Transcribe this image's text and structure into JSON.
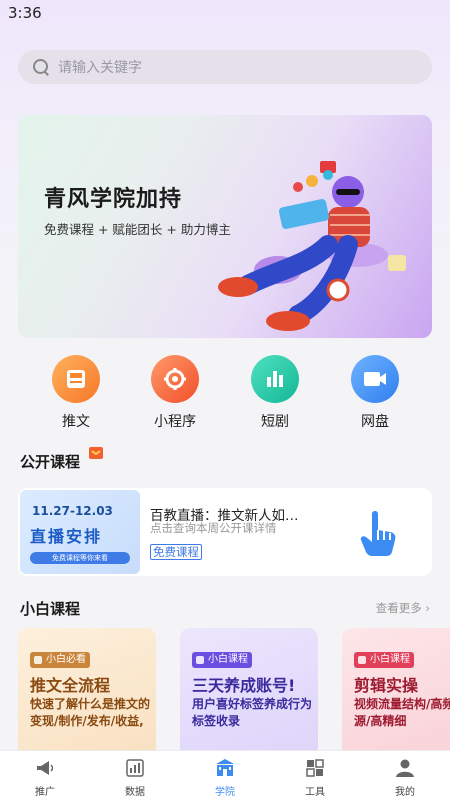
{
  "status_bar": {
    "time": "3:36"
  },
  "search": {
    "placeholder": "请输入关键字"
  },
  "banner": {
    "title": "青风学院加持",
    "subtitle": "免费课程 + 赋能团长 + 助力博主"
  },
  "quick_actions": [
    {
      "label": "推文",
      "icon": "book-icon",
      "color": "#f6872f"
    },
    {
      "label": "小程序",
      "icon": "gear-wrench-icon",
      "color": "#f5602f"
    },
    {
      "label": "短剧",
      "icon": "bar-chart-icon",
      "color": "#1bc7a6"
    },
    {
      "label": "网盘",
      "icon": "video-camera-icon",
      "color": "#3d8cf4"
    }
  ],
  "open_courses": {
    "title": "公开课程",
    "card": {
      "thumb_date": "11.27-12.03",
      "thumb_main": "直播安排",
      "thumb_pill": "免费课程等你来看",
      "title": "百教直播：推文新人如…",
      "subtitle": "点击查询本周公开课详情",
      "tag": "免费课程"
    }
  },
  "beginner_courses": {
    "title": "小白课程",
    "more": "查看更多",
    "cards": [
      {
        "tag": "小白必看",
        "title": "推文全流程",
        "desc": "快速了解什么是推文的变现/制作/发布/收益,",
        "bg": "#fbead2",
        "tag_color": "#c9853b",
        "text_color": "#8a4a12"
      },
      {
        "tag": "小白课程",
        "title": "三天养成账号!",
        "desc": "用户喜好标签养成行为标签收录",
        "bg": "#e6e0fb",
        "tag_color": "#6b4fe0",
        "text_color": "#3a2a9e"
      },
      {
        "tag": "小白课程",
        "title": "剪辑实操",
        "desc": "视频流量结构/高频来源/高精细",
        "bg": "#fbe1e4",
        "tag_color": "#e0405a",
        "text_color": "#9e1a30"
      }
    ]
  },
  "tabbar": {
    "active_color": "#3d8cf4",
    "items": [
      {
        "label": "推广",
        "icon": "megaphone-icon",
        "active": false
      },
      {
        "label": "数据",
        "icon": "chart-icon",
        "active": false
      },
      {
        "label": "学院",
        "icon": "school-icon",
        "active": true
      },
      {
        "label": "工具",
        "icon": "tools-icon",
        "active": false
      },
      {
        "label": "我的",
        "icon": "person-icon",
        "active": false
      }
    ]
  }
}
